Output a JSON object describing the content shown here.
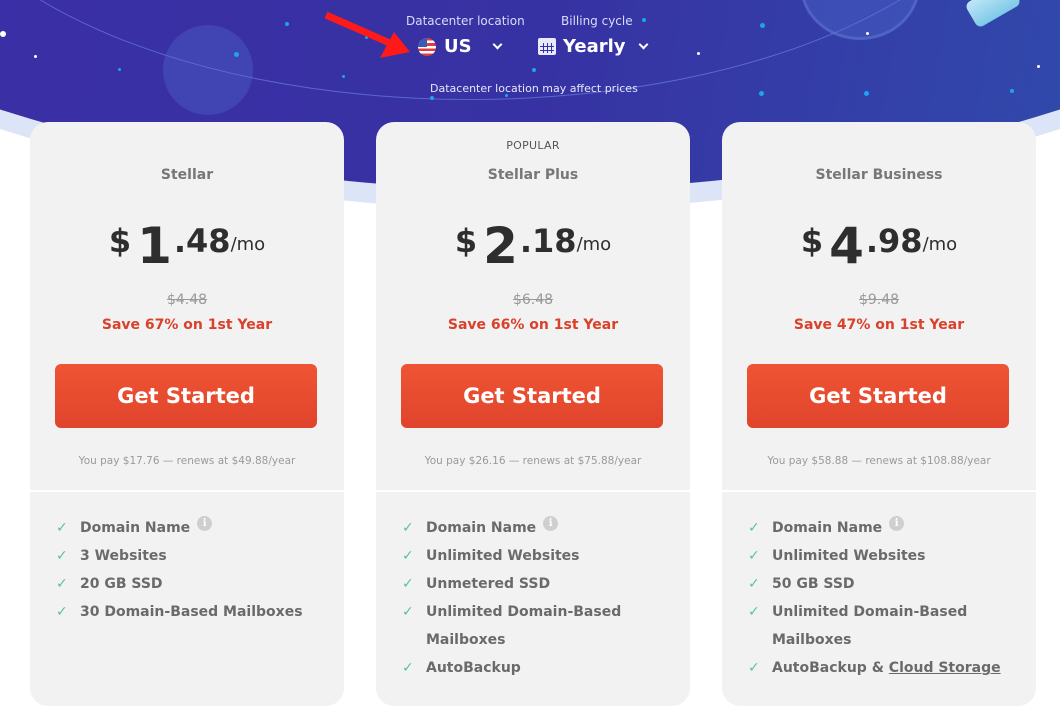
{
  "selectors": {
    "location": {
      "label": "Datacenter location",
      "value": "US",
      "icon": "us-flag-icon"
    },
    "billing": {
      "label": "Billing cycle",
      "value": "Yearly",
      "icon": "calendar-icon"
    },
    "note": "Datacenter location may affect prices"
  },
  "colors": {
    "hero": "#3732a3",
    "cta": "#e8492f",
    "save": "#d9412a",
    "check": "#5bbfae",
    "card": "#f2f2f2",
    "annotation_arrow": "#ff1a1a"
  },
  "plans": [
    {
      "badge": "",
      "name": "Stellar",
      "currency": "$",
      "price_whole": "1",
      "price_cents": ".48",
      "per": "/mo",
      "old_price": "$4.48",
      "save": "Save 67% on 1st Year",
      "cta": "Get Started",
      "renew": "You pay $17.76 — renews at $49.88/year",
      "features": [
        {
          "text": "Domain Name",
          "info": true
        },
        {
          "text": "3 Websites"
        },
        {
          "text": "20 GB SSD"
        },
        {
          "text": "30 Domain-Based Mailboxes"
        }
      ]
    },
    {
      "badge": "POPULAR",
      "name": "Stellar Plus",
      "currency": "$",
      "price_whole": "2",
      "price_cents": ".18",
      "per": "/mo",
      "old_price": "$6.48",
      "save": "Save 66% on 1st Year",
      "cta": "Get Started",
      "renew": "You pay $26.16 — renews at $75.88/year",
      "features": [
        {
          "text": "Domain Name",
          "info": true
        },
        {
          "text": "Unlimited Websites"
        },
        {
          "text": "Unmetered SSD"
        },
        {
          "text": "Unlimited Domain-Based Mailboxes"
        },
        {
          "text": "AutoBackup"
        }
      ]
    },
    {
      "badge": "",
      "name": "Stellar Business",
      "currency": "$",
      "price_whole": "4",
      "price_cents": ".98",
      "per": "/mo",
      "old_price": "$9.48",
      "save": "Save 47% on 1st Year",
      "cta": "Get Started",
      "renew": "You pay $58.88 — renews at $108.88/year",
      "features": [
        {
          "text": "Domain Name",
          "info": true
        },
        {
          "text": "Unlimited Websites"
        },
        {
          "text": "50 GB SSD"
        },
        {
          "text": "Unlimited Domain-Based Mailboxes"
        },
        {
          "text": "AutoBackup & ",
          "link": "Cloud Storage"
        }
      ]
    }
  ]
}
